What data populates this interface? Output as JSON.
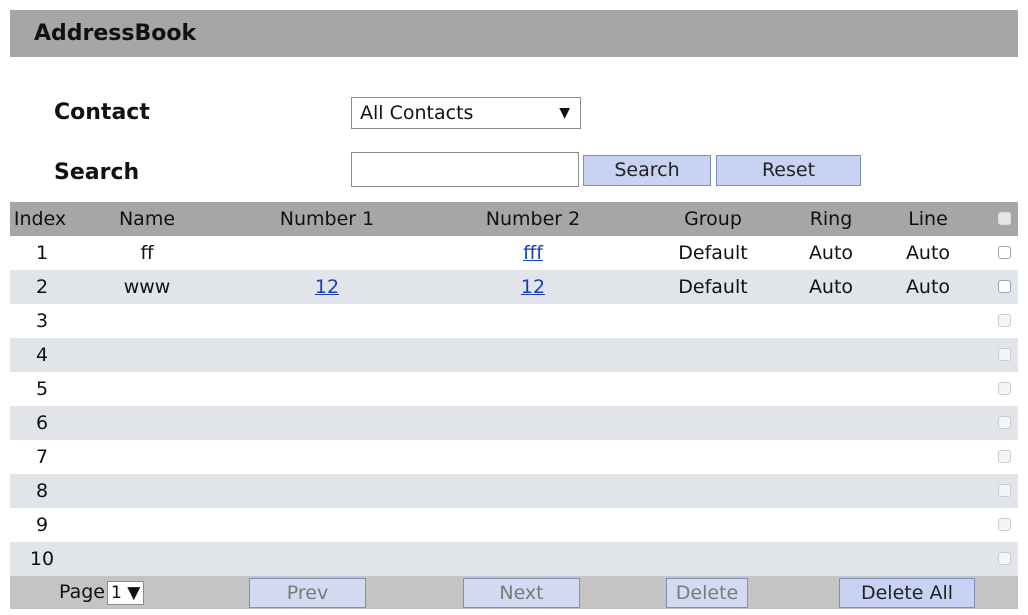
{
  "header": {
    "title": "AddressBook"
  },
  "filters": {
    "contact_label": "Contact",
    "contact_value": "All Contacts",
    "search_label": "Search",
    "search_value": "",
    "search_button": "Search",
    "reset_button": "Reset"
  },
  "table": {
    "columns": [
      "Index",
      "Name",
      "Number 1",
      "Number 2",
      "Group",
      "Ring",
      "Line"
    ],
    "rows": [
      {
        "index": "1",
        "name": "ff",
        "number1": "",
        "number2": "fff",
        "group": "Default",
        "ring": "Auto",
        "line": "Auto"
      },
      {
        "index": "2",
        "name": "www",
        "number1": "12",
        "number2": "12",
        "group": "Default",
        "ring": "Auto",
        "line": "Auto"
      },
      {
        "index": "3",
        "name": "",
        "number1": "",
        "number2": "",
        "group": "",
        "ring": "",
        "line": ""
      },
      {
        "index": "4",
        "name": "",
        "number1": "",
        "number2": "",
        "group": "",
        "ring": "",
        "line": ""
      },
      {
        "index": "5",
        "name": "",
        "number1": "",
        "number2": "",
        "group": "",
        "ring": "",
        "line": ""
      },
      {
        "index": "6",
        "name": "",
        "number1": "",
        "number2": "",
        "group": "",
        "ring": "",
        "line": ""
      },
      {
        "index": "7",
        "name": "",
        "number1": "",
        "number2": "",
        "group": "",
        "ring": "",
        "line": ""
      },
      {
        "index": "8",
        "name": "",
        "number1": "",
        "number2": "",
        "group": "",
        "ring": "",
        "line": ""
      },
      {
        "index": "9",
        "name": "",
        "number1": "",
        "number2": "",
        "group": "",
        "ring": "",
        "line": ""
      },
      {
        "index": "10",
        "name": "",
        "number1": "",
        "number2": "",
        "group": "",
        "ring": "",
        "line": ""
      }
    ]
  },
  "footer": {
    "page_label": "Page",
    "page_value": "1",
    "prev": "Prev",
    "next": "Next",
    "delete": "Delete",
    "delete_all": "Delete All"
  }
}
